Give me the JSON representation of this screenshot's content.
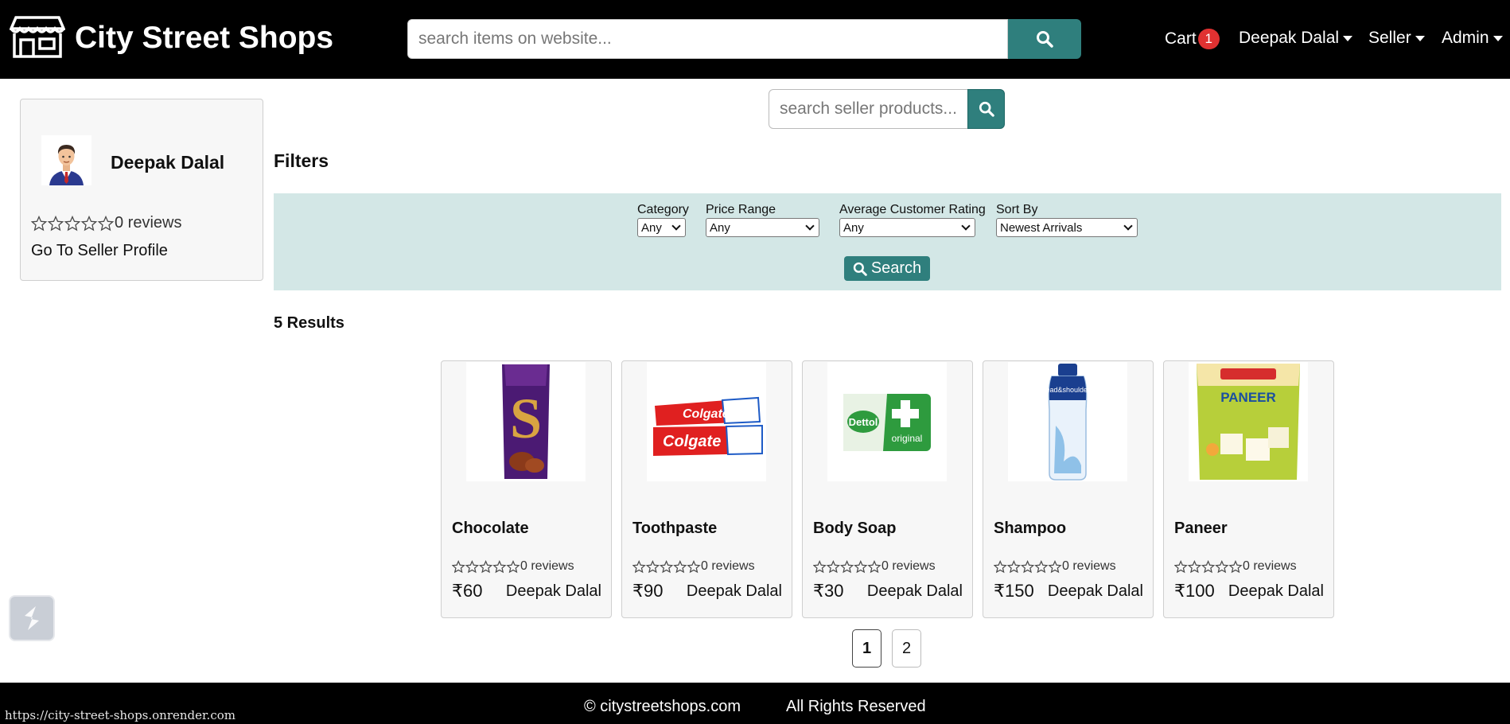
{
  "header": {
    "brand": "City Street Shops",
    "search_placeholder": "search items on website...",
    "cart_label": "Cart",
    "cart_count": "1",
    "user_menu": "Deepak Dalal",
    "seller_menu": "Seller",
    "admin_menu": "Admin"
  },
  "seller": {
    "name": "Deepak Dalal",
    "rating_stars": 0,
    "reviews": "0 reviews",
    "profile_link": "Go To Seller Profile"
  },
  "seller_search": {
    "placeholder": "search seller products..."
  },
  "filters": {
    "title": "Filters",
    "category": {
      "label": "Category",
      "value": "Any"
    },
    "price": {
      "label": "Price Range",
      "value": "Any"
    },
    "rating": {
      "label": "Average Customer Rating",
      "value": "Any"
    },
    "sort": {
      "label": "Sort By",
      "value": "Newest Arrivals"
    },
    "search_button": "Search"
  },
  "results": {
    "count_label": "5 Results",
    "products": [
      {
        "name": "Chocolate",
        "reviews": "0 reviews",
        "price": "₹60",
        "seller": "Deepak Dalal"
      },
      {
        "name": "Toothpaste",
        "reviews": "0 reviews",
        "price": "₹90",
        "seller": "Deepak Dalal"
      },
      {
        "name": "Body Soap",
        "reviews": "0 reviews",
        "price": "₹30",
        "seller": "Deepak Dalal"
      },
      {
        "name": "Shampoo",
        "reviews": "0 reviews",
        "price": "₹150",
        "seller": "Deepak Dalal"
      },
      {
        "name": "Paneer",
        "reviews": "0 reviews",
        "price": "₹100",
        "seller": "Deepak Dalal"
      }
    ]
  },
  "pagination": {
    "pages": [
      "1",
      "2"
    ],
    "current": "1"
  },
  "footer": {
    "copyright": "© citystreetshops.com",
    "rights": "All Rights Reserved"
  },
  "status_bar": {
    "url": "https://city-street-shops.onrender.com"
  },
  "colors": {
    "accent": "#2f7f7d",
    "filter_bg": "#d3e7e6",
    "badge": "#e03131",
    "header_bg": "#000000"
  },
  "icons": [
    "shop-icon",
    "search-icon",
    "caret-down-icon",
    "star-outline-icon",
    "avatar-icon",
    "widget-icon"
  ]
}
